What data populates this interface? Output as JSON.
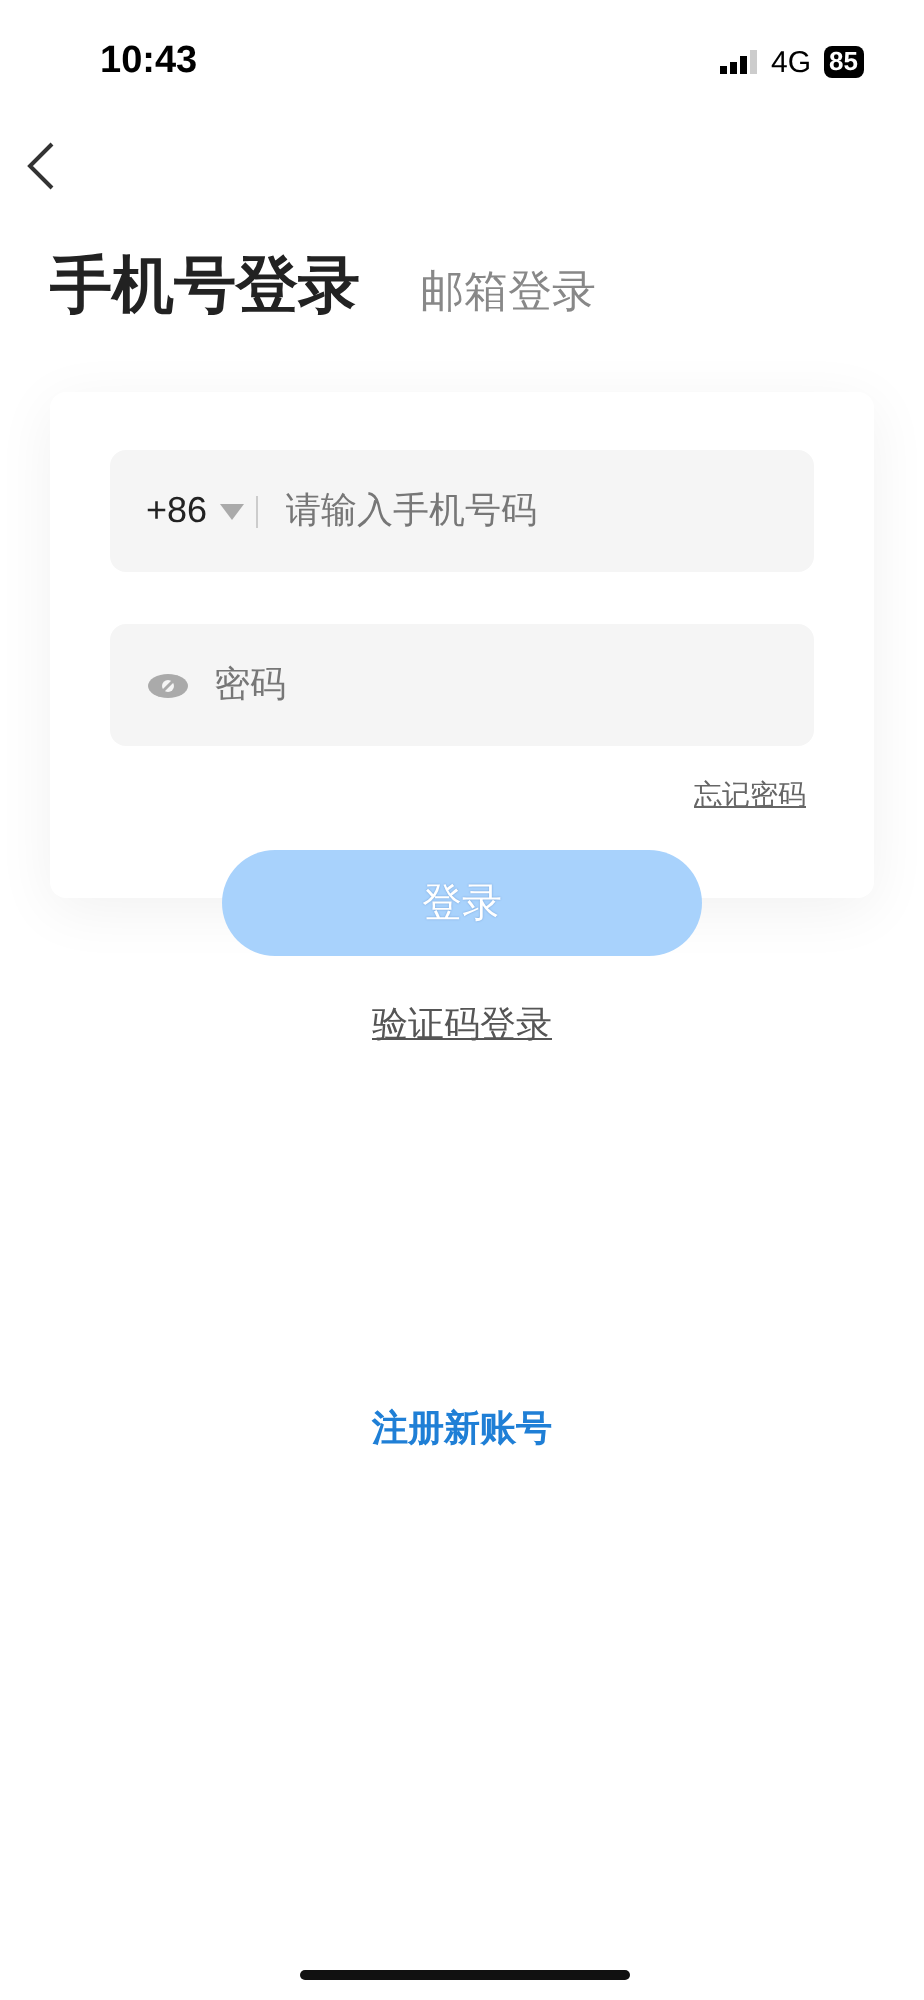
{
  "status_bar": {
    "time": "10:43",
    "network": "4G",
    "battery": "85"
  },
  "tabs": [
    {
      "label": "手机号登录",
      "selected": true
    },
    {
      "label": "邮箱登录",
      "selected": false
    }
  ],
  "phone_field": {
    "country_code": "+86",
    "placeholder": "请输入手机号码"
  },
  "password_field": {
    "placeholder": "密码"
  },
  "forgot_link": "忘记密码",
  "login_button": {
    "label": "登录",
    "disabled": true
  },
  "code_login_link": "验证码登录",
  "register_link": "注册新账号"
}
